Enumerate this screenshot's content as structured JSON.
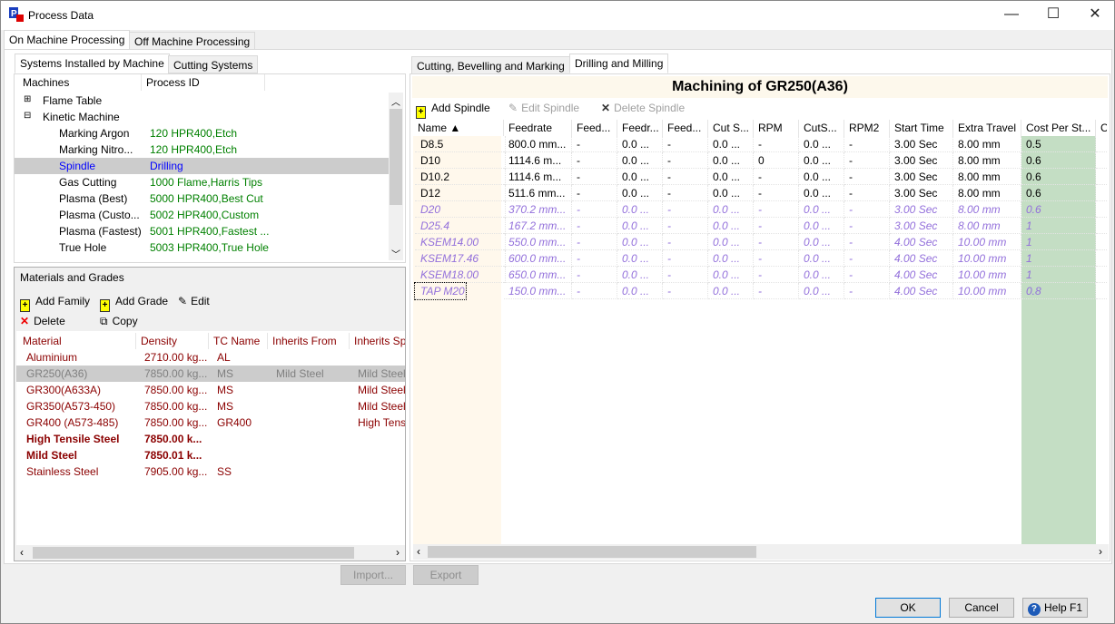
{
  "window": {
    "title": "Process Data",
    "minimize": "—",
    "maximize": "☐",
    "close": "✕"
  },
  "main_tabs": [
    "On Machine Processing",
    "Off Machine Processing"
  ],
  "left": {
    "tabs": [
      "Systems Installed by Machine",
      "Cutting Systems"
    ],
    "tree_headers": [
      "Machines",
      "Process ID"
    ],
    "tree": [
      {
        "label": "Flame Table",
        "process": "",
        "level": 0,
        "expander": "+"
      },
      {
        "label": "Kinetic Machine",
        "process": "",
        "level": 0,
        "expander": "−"
      },
      {
        "label": "Marking Argon",
        "process": "120 HPR400,Etch",
        "level": 1
      },
      {
        "label": "Marking Nitro...",
        "process": "120 HPR400,Etch",
        "level": 1
      },
      {
        "label": "Spindle",
        "process": "Drilling",
        "level": 1,
        "selected": true
      },
      {
        "label": "Gas Cutting",
        "process": "1000 Flame,Harris Tips",
        "level": 1
      },
      {
        "label": "Plasma (Best)",
        "process": "5000 HPR400,Best Cut",
        "level": 1
      },
      {
        "label": "Plasma (Custo...",
        "process": "5002 HPR400,Custom",
        "level": 1
      },
      {
        "label": "Plasma (Fastest)",
        "process": "5001 HPR400,Fastest ...",
        "level": 1
      },
      {
        "label": "True Hole",
        "process": "5003 HPR400,True Hole",
        "level": 1
      }
    ],
    "materials": {
      "title": "Materials and Grades",
      "add_family": "Add Family",
      "add_grade": "Add Grade",
      "edit": "Edit",
      "delete": "Delete",
      "copy": "Copy",
      "headers": [
        "Material",
        "Density",
        "TC Name",
        "Inherits From",
        "Inherits Spi"
      ],
      "rows": [
        {
          "cells": [
            "Aluminium",
            "2710.00 kg...",
            "AL",
            "",
            ""
          ]
        },
        {
          "cells": [
            "GR250(A36)",
            "7850.00 kg...",
            "MS",
            "Mild Steel",
            "Mild Steel"
          ],
          "selected": true
        },
        {
          "cells": [
            "GR300(A633A)",
            "7850.00 kg...",
            "MS",
            "",
            "Mild Steel"
          ]
        },
        {
          "cells": [
            "GR350(A573-450)",
            "7850.00 kg...",
            "MS",
            "",
            "Mild Steel"
          ]
        },
        {
          "cells": [
            "GR400 (A573-485)",
            "7850.00 kg...",
            "GR400",
            "",
            "High Tens"
          ]
        },
        {
          "cells": [
            "High Tensile Steel",
            "7850.00 k...",
            "",
            "",
            ""
          ],
          "bold": true
        },
        {
          "cells": [
            "Mild Steel",
            "7850.01 k...",
            "",
            "",
            ""
          ],
          "bold": true
        },
        {
          "cells": [
            "Stainless Steel",
            "7905.00 kg...",
            "SS",
            "",
            ""
          ]
        }
      ]
    }
  },
  "right": {
    "tabs": [
      "Cutting, Bevelling and Marking",
      "Drilling and Milling"
    ],
    "heading": "Machining of GR250(A36)",
    "add_spindle": "Add Spindle",
    "edit_spindle": "Edit Spindle",
    "delete_spindle": "Delete Spindle",
    "headers": [
      "Name ▲",
      "Feedrate",
      "Feed...",
      "Feedr...",
      "Feed...",
      "Cut S...",
      "RPM",
      "CutS...",
      "RPM2",
      "Start Time",
      "Extra Travel",
      "Cost Per St...",
      "C"
    ],
    "rows": [
      {
        "cells": [
          "D8.5",
          "800.0 mm...",
          "-",
          "0.0 ...",
          "-",
          "0.0 ...",
          "-",
          "0.0 ...",
          "-",
          "3.00 Sec",
          "8.00 mm",
          "0.5",
          ""
        ]
      },
      {
        "cells": [
          "D10",
          "1114.6 m...",
          "-",
          "0.0 ...",
          "-",
          "0.0 ...",
          "0",
          "0.0 ...",
          "-",
          "3.00 Sec",
          "8.00 mm",
          "0.6",
          ""
        ]
      },
      {
        "cells": [
          "D10.2",
          "1114.6 m...",
          "-",
          "0.0 ...",
          "-",
          "0.0 ...",
          "-",
          "0.0 ...",
          "-",
          "3.00 Sec",
          "8.00 mm",
          "0.6",
          ""
        ]
      },
      {
        "cells": [
          "D12",
          "511.6 mm...",
          "-",
          "0.0 ...",
          "-",
          "0.0 ...",
          "-",
          "0.0 ...",
          "-",
          "3.00 Sec",
          "8.00 mm",
          "0.6",
          ""
        ]
      },
      {
        "cells": [
          "D20",
          "370.2 mm...",
          "-",
          "0.0 ...",
          "-",
          "0.0 ...",
          "-",
          "0.0 ...",
          "-",
          "3.00 Sec",
          "8.00 mm",
          "0.6",
          ""
        ],
        "inherited": true
      },
      {
        "cells": [
          "D25.4",
          "167.2 mm...",
          "-",
          "0.0 ...",
          "-",
          "0.0 ...",
          "-",
          "0.0 ...",
          "-",
          "3.00 Sec",
          "8.00 mm",
          "1",
          ""
        ],
        "inherited": true
      },
      {
        "cells": [
          "KSEM14.00",
          "550.0 mm...",
          "-",
          "0.0 ...",
          "-",
          "0.0 ...",
          "-",
          "0.0 ...",
          "-",
          "4.00 Sec",
          "10.00 mm",
          "1",
          ""
        ],
        "inherited": true
      },
      {
        "cells": [
          "KSEM17.46",
          "600.0 mm...",
          "-",
          "0.0 ...",
          "-",
          "0.0 ...",
          "-",
          "0.0 ...",
          "-",
          "4.00 Sec",
          "10.00 mm",
          "1",
          ""
        ],
        "inherited": true
      },
      {
        "cells": [
          "KSEM18.00",
          "650.0 mm...",
          "-",
          "0.0 ...",
          "-",
          "0.0 ...",
          "-",
          "0.0 ...",
          "-",
          "4.00 Sec",
          "10.00 mm",
          "1",
          ""
        ],
        "inherited": true
      },
      {
        "cells": [
          "TAP M20",
          "150.0 mm...",
          "-",
          "0.0 ...",
          "-",
          "0.0 ...",
          "-",
          "0.0 ...",
          "-",
          "4.00 Sec",
          "10.00 mm",
          "0.8",
          ""
        ],
        "inherited": true,
        "focused": true
      }
    ]
  },
  "buttons": {
    "import": "Import...",
    "export": "Export",
    "ok": "OK",
    "cancel": "Cancel",
    "help": "Help F1"
  },
  "colors": {
    "selected_row": "#cccccc",
    "tree_selected_text": "#0000ff",
    "process_id": "#008000",
    "material_text": "#8b0000",
    "inherited_text": "#9370db",
    "cost_column": "#c4dec4",
    "name_column": "#fff8ec"
  }
}
